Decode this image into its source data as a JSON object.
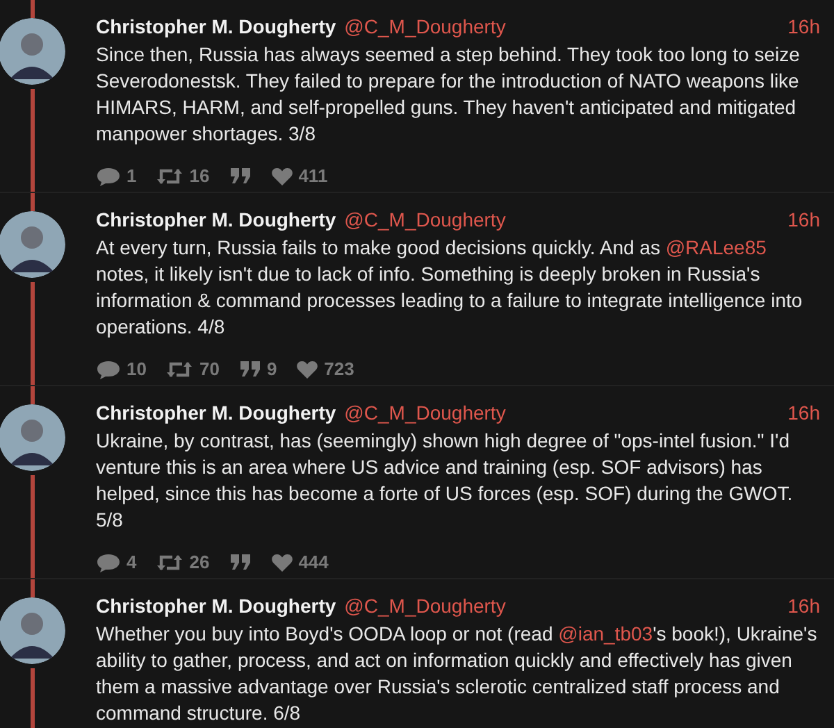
{
  "tweets": [
    {
      "name": "Christopher M. Dougherty",
      "handle": "@C_M_Dougherty",
      "time": "16h",
      "body": [
        {
          "kind": "text",
          "text": "Since then, Russia has always seemed a step behind. They took too long to seize Severodonestsk. They failed to prepare for the introduction of NATO weapons like HIMARS, HARM, and self-propelled guns. They haven't anticipated and mitigated manpower shortages. 3/8"
        }
      ],
      "stats": [
        {
          "kind": "reply",
          "count": "1"
        },
        {
          "kind": "retweet",
          "count": "16"
        },
        {
          "kind": "quote"
        },
        {
          "kind": "like",
          "count": "411"
        }
      ]
    },
    {
      "name": "Christopher M. Dougherty",
      "handle": "@C_M_Dougherty",
      "time": "16h",
      "body": [
        {
          "kind": "text",
          "text": "At every turn, Russia fails to make good decisions quickly. And as "
        },
        {
          "kind": "mention",
          "text": "@RALee85"
        },
        {
          "kind": "text",
          "text": " notes, it likely isn't due to lack of info. Something is deeply broken in Russia's information & command processes leading to a failure to integrate intelligence into operations. 4/8"
        }
      ],
      "stats": [
        {
          "kind": "reply",
          "count": "10"
        },
        {
          "kind": "retweet",
          "count": "70"
        },
        {
          "kind": "quote",
          "count": "9"
        },
        {
          "kind": "like",
          "count": "723"
        }
      ]
    },
    {
      "name": "Christopher M. Dougherty",
      "handle": "@C_M_Dougherty",
      "time": "16h",
      "body": [
        {
          "kind": "text",
          "text": "Ukraine, by contrast, has (seemingly) shown high degree of \"ops-intel fusion.\" I'd venture this is an area where US advice and training (esp. SOF advisors) has helped, since this has become a forte of US forces (esp. SOF) during the GWOT. 5/8"
        }
      ],
      "stats": [
        {
          "kind": "reply",
          "count": "4"
        },
        {
          "kind": "retweet",
          "count": "26"
        },
        {
          "kind": "quote"
        },
        {
          "kind": "like",
          "count": "444"
        }
      ]
    },
    {
      "name": "Christopher M. Dougherty",
      "handle": "@C_M_Dougherty",
      "time": "16h",
      "body": [
        {
          "kind": "text",
          "text": "Whether you buy into Boyd's OODA loop or not (read "
        },
        {
          "kind": "mention",
          "text": "@ian_tb03"
        },
        {
          "kind": "text",
          "text": "'s book!), Ukraine's ability to gather, process, and act on information quickly and effectively has given them a massive advantage over Russia's sclerotic centralized staff process and command structure. 6/8"
        }
      ]
    }
  ]
}
